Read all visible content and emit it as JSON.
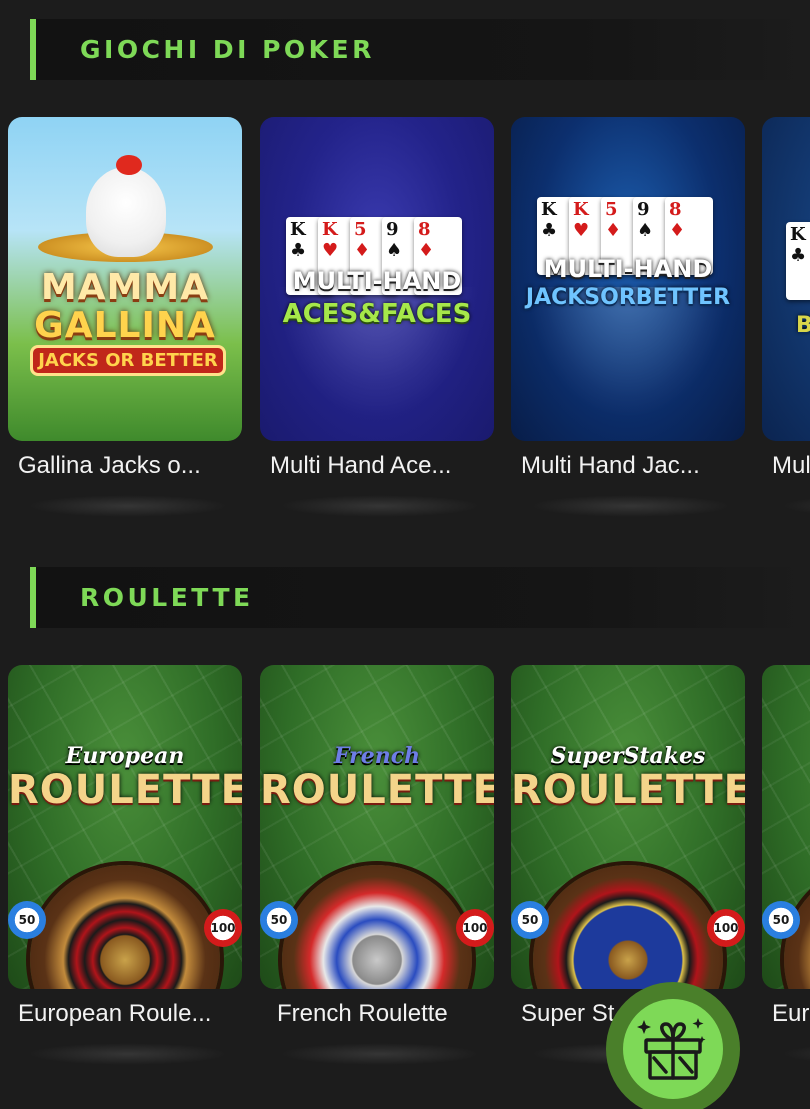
{
  "sections": [
    {
      "title": "GIOCHI DI POKER",
      "games": [
        {
          "title": "Gallina Jacks o...",
          "art": {
            "logo_line1": "MAMMA",
            "logo_line2": "GALLINA",
            "logo_line3": "JACKS OR BETTER"
          }
        },
        {
          "title": "Multi Hand Ace...",
          "art": {
            "line1": "MULTI-HAND",
            "line2": "ACES&FACES"
          }
        },
        {
          "title": "Multi Hand Jac...",
          "art": {
            "line1": "MULTI-HAND",
            "line2": "JACKSORBETTER"
          }
        },
        {
          "title": "Mul",
          "art": {
            "line2": "B"
          }
        }
      ]
    },
    {
      "title": "ROULETTE",
      "games": [
        {
          "title": "European Roule...",
          "art": {
            "script": "European",
            "big": "ROULETTE",
            "chip_left": "50",
            "chip_right": "100"
          }
        },
        {
          "title": "French Roulette",
          "art": {
            "script": "French",
            "big": "ROULETTE",
            "chip_left": "50",
            "chip_right": "100"
          }
        },
        {
          "title": "Super St",
          "art": {
            "script": "SuperStakes",
            "big": "ROULETTE",
            "chip_left": "50",
            "chip_right": "100"
          }
        },
        {
          "title": "Eur",
          "art": {
            "chip_left": "50"
          }
        }
      ]
    }
  ],
  "cards": [
    {
      "rank": "K",
      "suit": "♣",
      "color": "black"
    },
    {
      "rank": "K",
      "suit": "♥",
      "color": "red"
    },
    {
      "rank": "5",
      "suit": "♦",
      "color": "red"
    },
    {
      "rank": "9",
      "suit": "♠",
      "color": "black"
    },
    {
      "rank": "8",
      "suit": "♦",
      "color": "red"
    }
  ],
  "fab": {
    "icon": "gift-icon"
  },
  "colors": {
    "accent": "#7ed957",
    "background": "#1c1c1c",
    "fab_ring": "#4a7f2a"
  }
}
